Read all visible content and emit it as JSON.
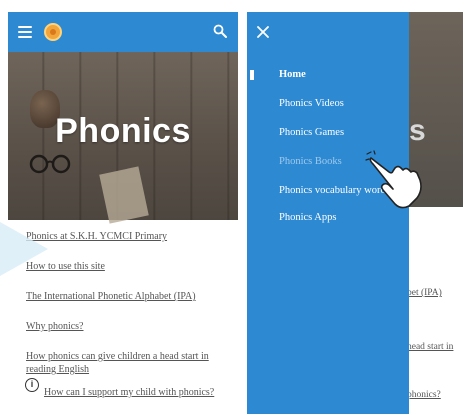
{
  "left_screen": {
    "hero_title": "Phonics",
    "links": [
      "Phonics at S.K.H. YCMCI Primary",
      "How to use this site",
      "The International Phonetic Alphabet (IPA)",
      "Why phonics?",
      "How phonics can give children a head start in reading English",
      "How can I support my child with phonics?"
    ],
    "icons": [
      "menu-icon",
      "logo-icon",
      "search-icon",
      "info-icon"
    ]
  },
  "right_screen": {
    "drawer_items": [
      "Home",
      "Phonics Videos",
      "Phonics Games",
      "Phonics Books",
      "Phonics vocabulary words",
      "Phonics Apps"
    ],
    "background_hero_fragment": "s",
    "background_link_fragments": [
      "bet (IPA)",
      "head start in",
      "phonics?"
    ],
    "icons": [
      "close-icon",
      "hand-pointer-icon"
    ]
  },
  "colors": {
    "primary_blue": "#2d8ad2",
    "muted_menu_text": "#9fc8ec",
    "link_text": "#555555"
  }
}
